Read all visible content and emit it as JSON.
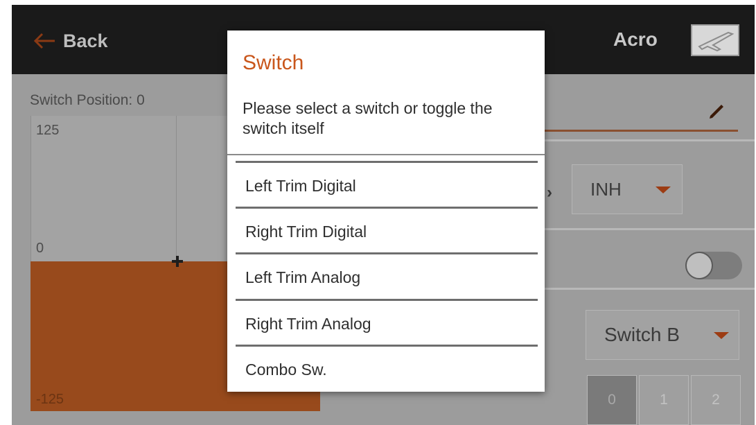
{
  "header": {
    "back_label": "Back",
    "model_name": "Acro",
    "back_icon": "arrow-left-icon",
    "model_icon": "airplane-icon"
  },
  "graph": {
    "switch_position_label": "Switch Position: 0",
    "y_top": "125",
    "y_mid": "0",
    "y_bottom": "-125"
  },
  "settings": {
    "inh_value": "INH",
    "switch_value": "Switch B",
    "toggle_on": false,
    "positions": [
      "0",
      "1",
      "2"
    ],
    "active_position": "0"
  },
  "dialog": {
    "title": "Switch",
    "message": "Please select a switch or toggle the switch itself",
    "options": [
      "Left Trim Digital",
      "Right Trim Digital",
      "Left Trim Analog",
      "Right Trim Analog",
      "Combo Sw."
    ]
  },
  "colors": {
    "accent": "#c9561b",
    "graph_fill": "#984a1c"
  }
}
